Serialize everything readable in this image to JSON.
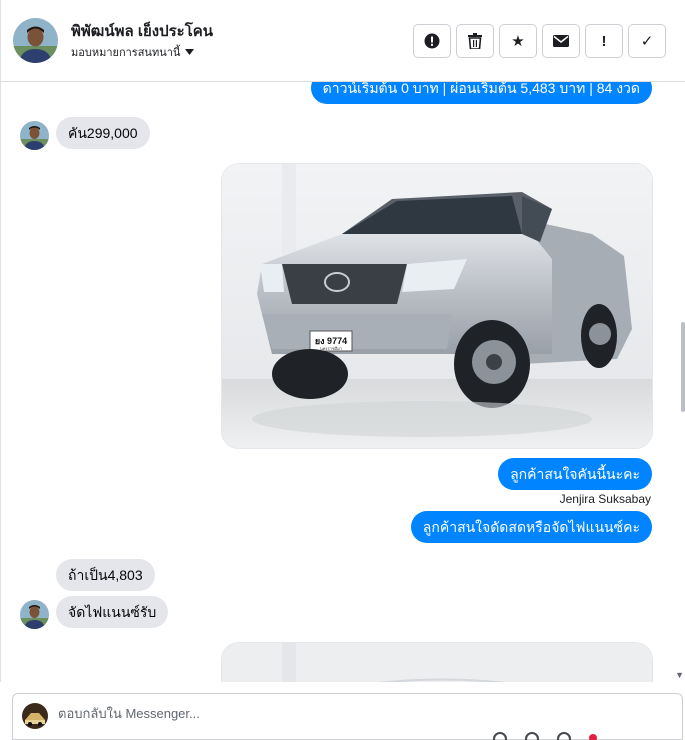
{
  "header": {
    "contact_name": "พิพัฒน์พล เย็งประโคน",
    "assign_label": "มอบหมายการสนทนานี้",
    "tools": [
      {
        "icon": "alert-circle-icon",
        "glyph": "!"
      },
      {
        "icon": "trash-icon",
        "glyph": ""
      },
      {
        "icon": "star-icon",
        "glyph": "★"
      },
      {
        "icon": "envelope-icon",
        "glyph": "✉"
      },
      {
        "icon": "exclamation-icon",
        "glyph": "!"
      },
      {
        "icon": "check-icon",
        "glyph": "✓"
      }
    ]
  },
  "thread": {
    "top_partial_message": "ดาวน์เริ่มต้น 0 บาท | ผ่อนเริ่มต้น 5,483 บาท | 84 งวด",
    "msg_price": "คัน299,000",
    "out_message_1": "ลูกค้าสนใจคันนี้นะคะ",
    "sender_name": "Jenjira Suksabay",
    "out_message_2": "ลูกค้าสนใจดัดสดหรือจัดไฟแนนซ์คะ",
    "in_message_1": "ถ้าเป็น4,803",
    "in_message_2": "จัดไฟแนนซ์รับ",
    "truck_plate": "ยง 9774",
    "truck_plate_sub": "นครราชสีมา"
  },
  "composer": {
    "placeholder": "ตอบกลับใน Messenger..."
  },
  "colors": {
    "accent": "#0084ff",
    "incoming_bubble": "#e4e6eb"
  }
}
